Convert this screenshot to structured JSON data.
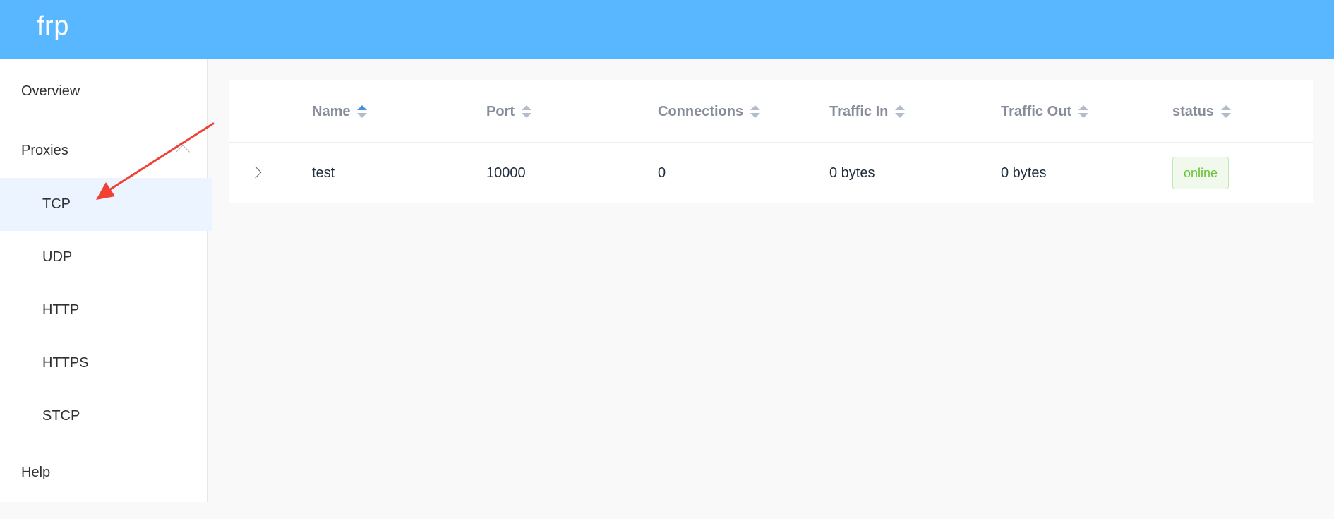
{
  "app": {
    "title": "frp"
  },
  "sidebar": {
    "overview": "Overview",
    "proxies": "Proxies",
    "proxy_types": [
      "TCP",
      "UDP",
      "HTTP",
      "HTTPS",
      "STCP"
    ],
    "help": "Help",
    "active": "TCP"
  },
  "table": {
    "columns": [
      "Name",
      "Port",
      "Connections",
      "Traffic In",
      "Traffic Out",
      "status"
    ],
    "sorted_column": "Name",
    "sort_direction": "ascending",
    "rows": [
      {
        "name": "test",
        "port": "10000",
        "connections": "0",
        "traffic_in": "0 bytes",
        "traffic_out": "0 bytes",
        "status": "online"
      }
    ]
  },
  "colors": {
    "header": "#58b7ff",
    "active_bg": "#ecf5ff",
    "status_online": "#67c23a",
    "annotation_arrow": "#f04134"
  }
}
